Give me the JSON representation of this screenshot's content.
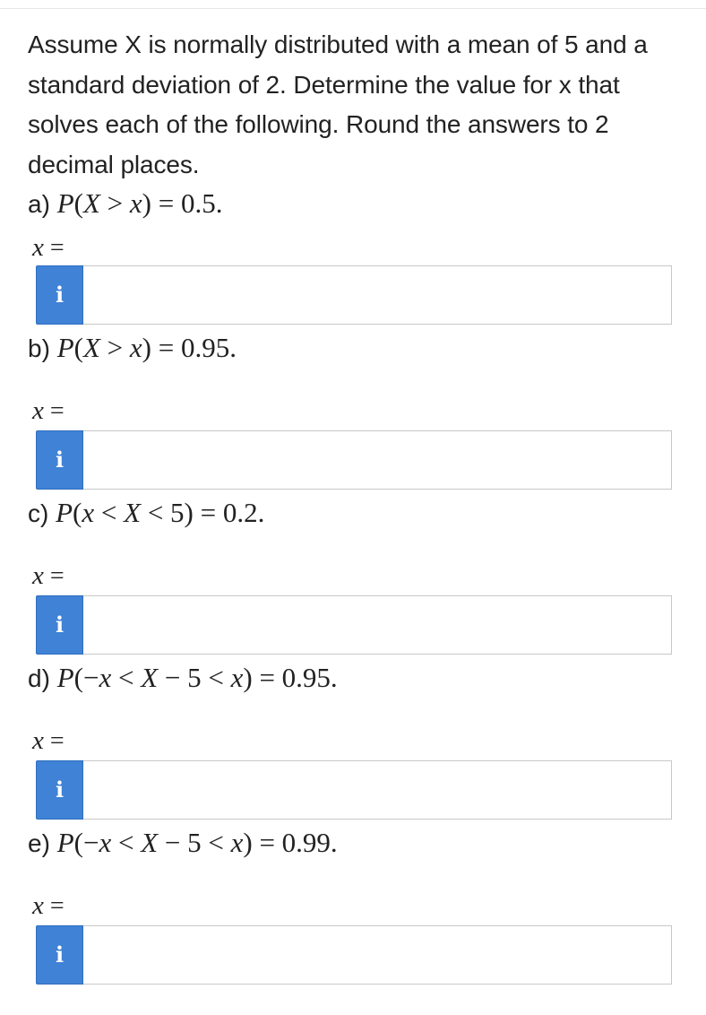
{
  "question": {
    "intro": "Assume X is normally distributed with a mean of 5 and a standard deviation of 2. Determine the value for x that solves each of the following. Round the answers to 2 decimal places."
  },
  "parts": [
    {
      "letter": "a)",
      "expression": "P(X > x) = 0.5.",
      "answer_label": "x =",
      "info_icon": "i",
      "answer_value": ""
    },
    {
      "letter": "b)",
      "expression": "P(X > x) = 0.95.",
      "answer_label": "x =",
      "info_icon": "i",
      "answer_value": ""
    },
    {
      "letter": "c)",
      "expression": "P(x < X < 5) = 0.2.",
      "answer_label": "x =",
      "info_icon": "i",
      "answer_value": ""
    },
    {
      "letter": "d)",
      "expression": "P(−x < X − 5 < x) = 0.95.",
      "answer_label": "x =",
      "info_icon": "i",
      "answer_value": ""
    },
    {
      "letter": "e)",
      "expression": "P(−x < X − 5 < x) = 0.99.",
      "answer_label": "x =",
      "info_icon": "i",
      "answer_value": ""
    }
  ],
  "colors": {
    "info_button": "#3f82d6",
    "input_border": "#c8c8c8",
    "text": "#222222"
  }
}
